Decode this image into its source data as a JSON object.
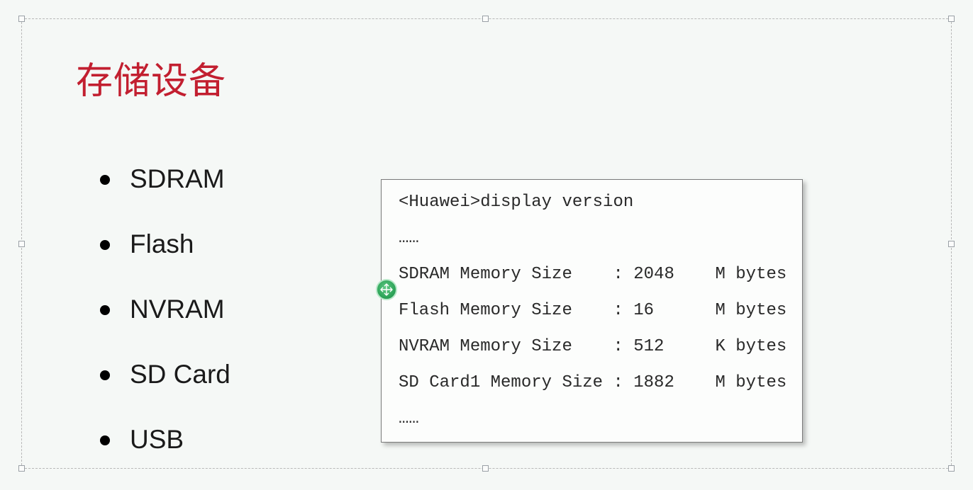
{
  "title": "存储设备",
  "bullets": [
    "SDRAM",
    "Flash",
    "NVRAM",
    "SD Card",
    "USB"
  ],
  "terminal": {
    "line0": "<Huawei>display version",
    "line1": "……",
    "line2": "SDRAM Memory Size    : 2048    M bytes",
    "line3": "Flash Memory Size    : 16      M bytes",
    "line4": "NVRAM Memory Size    : 512     K bytes",
    "line5": "SD Card1 Memory Size : 1882    M bytes",
    "line6": "……"
  }
}
